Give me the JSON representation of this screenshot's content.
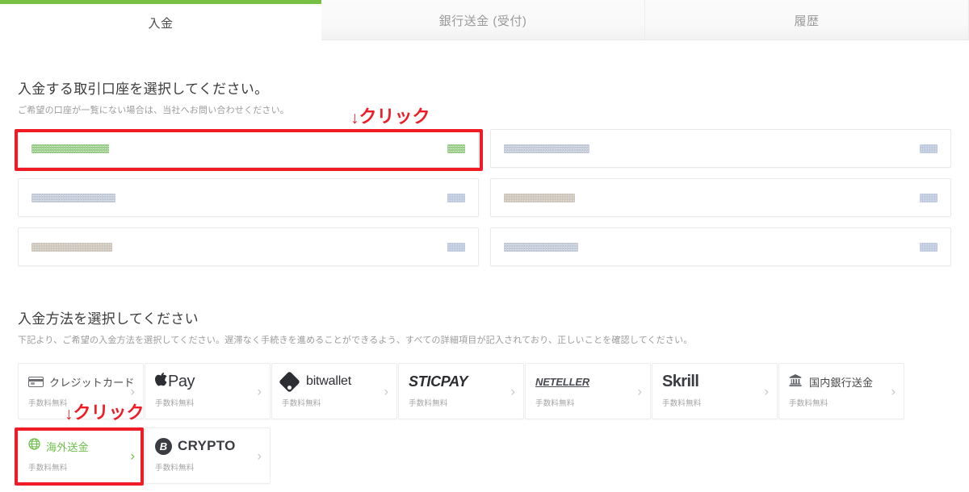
{
  "theme": {
    "accent_green": "#76c044",
    "annotation_red": "#ef1c26",
    "text_primary": "#3b3b3b",
    "text_muted": "#9b9b9b"
  },
  "tabs": [
    {
      "label": "入金",
      "active": true
    },
    {
      "label": "銀行送金 (受付)",
      "active": false
    },
    {
      "label": "履歴",
      "active": false
    }
  ],
  "accounts_section": {
    "title": "入金する取引口座を選択してください。",
    "subtitle": "ご希望の口座が一覧にない場合は、当社へお問い合わせください。",
    "cards": [
      {
        "label_redacted": true,
        "value_redacted": true,
        "highlighted": true,
        "label_width": 96,
        "value_width": 22,
        "label_style": "redact-green",
        "value_style": "redact-green"
      },
      {
        "label_redacted": true,
        "value_redacted": true,
        "highlighted": false,
        "label_width": 104,
        "value_width": 22,
        "label_style": "redact-mix",
        "value_style": "redact-blue"
      },
      {
        "label_redacted": true,
        "value_redacted": true,
        "highlighted": false,
        "label_width": 100,
        "value_width": 22,
        "label_style": "redact-warm",
        "value_style": "redact-blue"
      },
      {
        "label_redacted": true,
        "value_redacted": true,
        "highlighted": false,
        "label_width": 106,
        "value_width": 22,
        "label_style": "redact-mix",
        "value_style": "redact-blue"
      },
      {
        "label_redacted": true,
        "value_redacted": true,
        "highlighted": false,
        "label_width": 88,
        "value_width": 22,
        "label_style": "redact-warm",
        "value_style": "redact-blue"
      },
      {
        "label_redacted": true,
        "value_redacted": true,
        "highlighted": false,
        "label_width": 92,
        "value_width": 22,
        "label_style": "redact-mix",
        "value_style": "redact-blue"
      }
    ]
  },
  "methods_section": {
    "title": "入金方法を選択してください",
    "subtitle": "下記より、ご希望の入金方法を選択してください。遅滞なく手続きを進めることができるよう、すべての詳細項目が記入されており、正しいことを確認してください。",
    "fee_label": "手数料無料",
    "chevron": "›",
    "cards": [
      {
        "name": "クレジットカード",
        "icon": "credit-card-icon",
        "kind": "text",
        "highlighted": false
      },
      {
        "name": "Pay",
        "icon": "apple-pay-icon",
        "kind": "apple",
        "highlighted": false
      },
      {
        "name": "bitwallet",
        "icon": "bitwallet-icon",
        "kind": "bitwallet",
        "highlighted": false
      },
      {
        "name": "STICPAY",
        "icon": "sticpay-icon",
        "kind": "sticpay",
        "highlighted": false
      },
      {
        "name": "NETELLER",
        "icon": "neteller-icon",
        "kind": "neteller",
        "highlighted": false
      },
      {
        "name": "Skrill",
        "icon": "skrill-icon",
        "kind": "skrill",
        "highlighted": false
      },
      {
        "name": "国内銀行送金",
        "icon": "bank-icon",
        "kind": "bank",
        "highlighted": false
      },
      {
        "name": "海外送金",
        "icon": "globe-icon",
        "kind": "globe",
        "highlighted": true
      },
      {
        "name": "CRYPTO",
        "icon": "bitcoin-icon",
        "kind": "crypto",
        "highlighted": false
      }
    ]
  },
  "annotations": [
    {
      "id": "account",
      "arrow": "↓",
      "label": "クリック"
    },
    {
      "id": "method",
      "arrow": "↓",
      "label": "クリック"
    }
  ]
}
